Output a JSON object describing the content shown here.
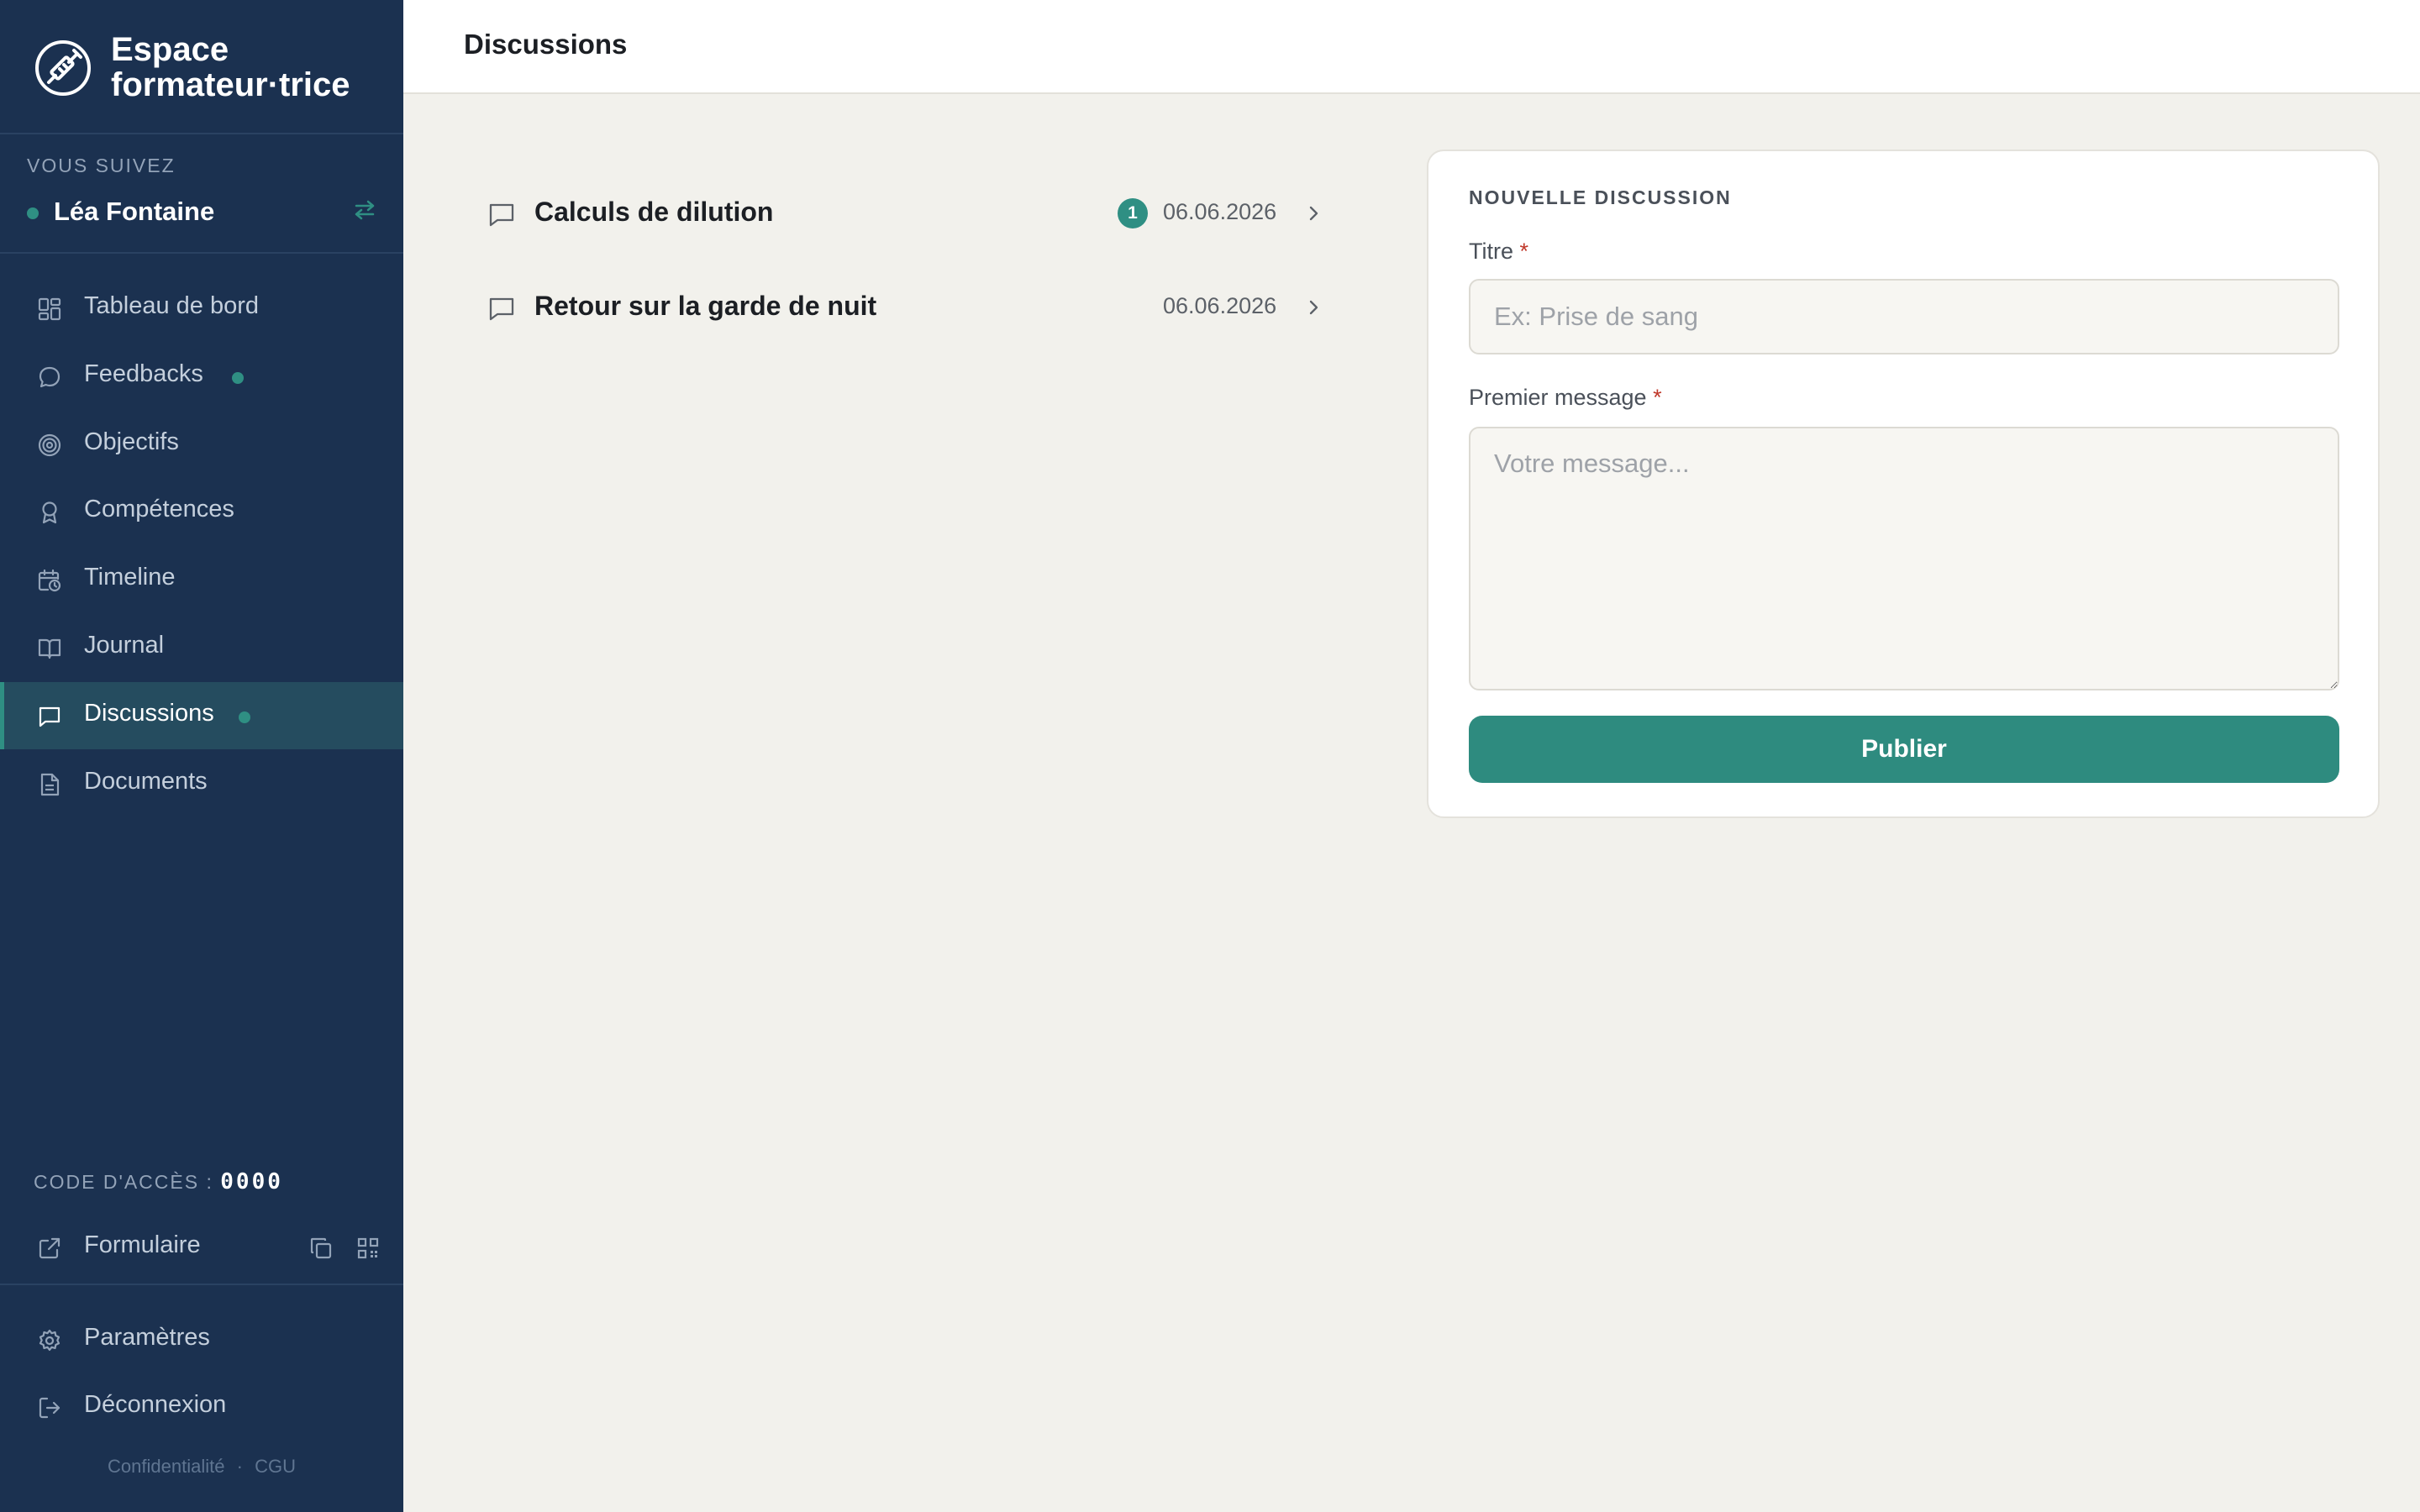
{
  "brand": {
    "line1": "Espace",
    "line2": "formateur·trice"
  },
  "follow": {
    "label": "VOUS SUIVEZ",
    "name": "Léa Fontaine"
  },
  "nav": {
    "dashboard": "Tableau de bord",
    "feedbacks": "Feedbacks",
    "objectives": "Objectifs",
    "skills": "Compétences",
    "timeline": "Timeline",
    "journal": "Journal",
    "discussions": "Discussions",
    "documents": "Documents"
  },
  "access": {
    "label": "CODE D'ACCÈS :",
    "code": "0000"
  },
  "form_link": "Formulaire",
  "settings": "Paramètres",
  "logout": "Déconnexion",
  "footer": {
    "privacy": "Confidentialité",
    "separator": "·",
    "terms": "CGU"
  },
  "page": {
    "title": "Discussions"
  },
  "discussions": [
    {
      "title": "Calculs de dilution",
      "unread": "1",
      "date": "06.06.2026"
    },
    {
      "title": "Retour sur la garde de nuit",
      "date": "06.06.2026"
    }
  ],
  "new_discussion": {
    "heading": "NOUVELLE DISCUSSION",
    "title_label": "Titre",
    "title_placeholder": "Ex: Prise de sang",
    "message_label": "Premier message",
    "message_placeholder": "Votre message...",
    "required_mark": "*",
    "submit": "Publier"
  },
  "colors": {
    "sidebar": "#1b3150",
    "accent": "#2e8b7f",
    "background": "#f2f1ec",
    "active_item": "#254c5f"
  }
}
